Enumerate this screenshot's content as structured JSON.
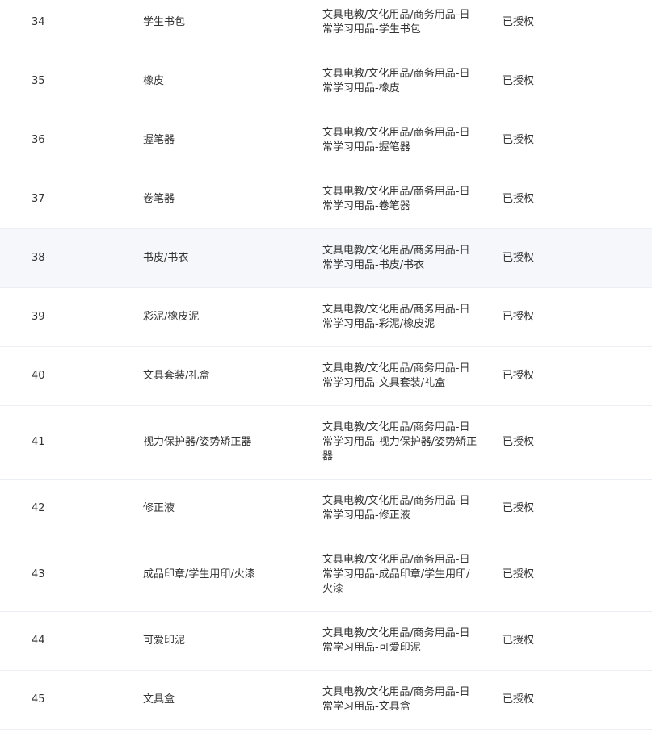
{
  "table": {
    "rows": [
      {
        "no": "34",
        "name": "学生书包",
        "category": "文具电教/文化用品/商务用品-日常学习用品-学生书包",
        "status": "已授权"
      },
      {
        "no": "35",
        "name": "橡皮",
        "category": "文具电教/文化用品/商务用品-日常学习用品-橡皮",
        "status": "已授权"
      },
      {
        "no": "36",
        "name": "握笔器",
        "category": "文具电教/文化用品/商务用品-日常学习用品-握笔器",
        "status": "已授权"
      },
      {
        "no": "37",
        "name": "卷笔器",
        "category": "文具电教/文化用品/商务用品-日常学习用品-卷笔器",
        "status": "已授权"
      },
      {
        "no": "38",
        "name": "书皮/书衣",
        "category": "文具电教/文化用品/商务用品-日常学习用品-书皮/书衣",
        "status": "已授权"
      },
      {
        "no": "39",
        "name": "彩泥/橡皮泥",
        "category": "文具电教/文化用品/商务用品-日常学习用品-彩泥/橡皮泥",
        "status": "已授权"
      },
      {
        "no": "40",
        "name": "文具套装/礼盒",
        "category": "文具电教/文化用品/商务用品-日常学习用品-文具套装/礼盒",
        "status": "已授权"
      },
      {
        "no": "41",
        "name": "视力保护器/姿势矫正器",
        "category": "文具电教/文化用品/商务用品-日常学习用品-视力保护器/姿势矫正器",
        "status": "已授权"
      },
      {
        "no": "42",
        "name": "修正液",
        "category": "文具电教/文化用品/商务用品-日常学习用品-修正液",
        "status": "已授权"
      },
      {
        "no": "43",
        "name": "成品印章/学生用印/火漆",
        "category": "文具电教/文化用品/商务用品-日常学习用品-成品印章/学生用印/火漆",
        "status": "已授权"
      },
      {
        "no": "44",
        "name": "可爱印泥",
        "category": "文具电教/文化用品/商务用品-日常学习用品-可爱印泥",
        "status": "已授权"
      },
      {
        "no": "45",
        "name": "文具盒",
        "category": "文具电教/文化用品/商务用品-日常学习用品-文具盒",
        "status": "已授权"
      }
    ]
  }
}
